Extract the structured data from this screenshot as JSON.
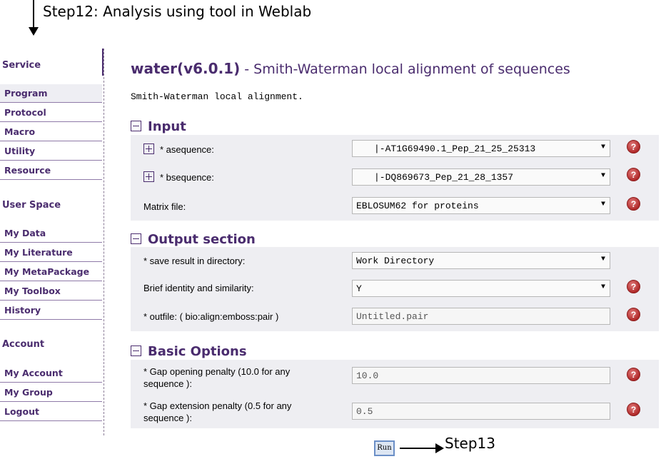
{
  "annotations": {
    "step12": "Step12: Analysis using tool in Weblab",
    "step13": "Step13"
  },
  "sidebar": {
    "service_heading": "Service",
    "service_items": [
      "Program",
      "Protocol",
      "Macro",
      "Utility",
      "Resource"
    ],
    "userspace_heading": "User Space",
    "userspace_items": [
      "My Data",
      "My Literature",
      "My MetaPackage",
      "My Toolbox",
      "History"
    ],
    "account_heading": "Account",
    "account_items": [
      "My Account",
      "My Group",
      "Logout"
    ]
  },
  "main": {
    "tool_name": "water(v6.0.1)",
    "tool_subtitle": " - Smith-Waterman local alignment of sequences",
    "description": "Smith-Waterman local alignment.",
    "input": {
      "heading": "Input",
      "asequence_label": "* asequence:",
      "asequence_value": "|-AT1G69490.1_Pep_21_25_25313",
      "bsequence_label": "* bsequence:",
      "bsequence_value": "|-DQ869673_Pep_21_28_1357",
      "matrix_label": "Matrix file:",
      "matrix_value": "EBLOSUM62 for proteins"
    },
    "output": {
      "heading": "Output section",
      "dir_label": "* save result in directory:",
      "dir_value": "Work Directory",
      "brief_label": "Brief identity and similarity:",
      "brief_value": "Y",
      "outfile_label": "* outfile:   ( bio:align:emboss:pair )",
      "outfile_value": "Untitled.pair"
    },
    "basic": {
      "heading": "Basic Options",
      "gapopen_label_1": "* Gap opening penalty (10.0 for any",
      "gapopen_label_2": "sequence ):",
      "gapopen_value": "10.0",
      "gapext_label_1": "* Gap extension penalty (0.5 for any",
      "gapext_label_2": "sequence ):",
      "gapext_value": "0.5"
    },
    "help_glyph": "?",
    "dropdown_glyph": "▼",
    "run_label": "Run"
  }
}
